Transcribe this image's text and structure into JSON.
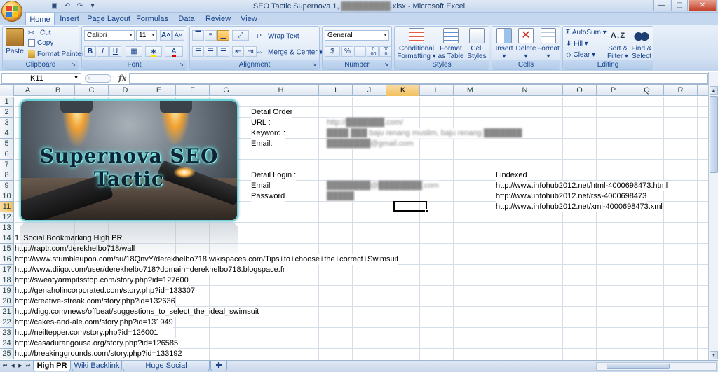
{
  "window": {
    "title": "SEO Tactic Supernova 1,",
    "title_suffix": ".xlsx - Microsoft Excel",
    "title_blurred": "█████████",
    "controls": {
      "minimize": "—",
      "maximize": "▢",
      "close": "✕"
    }
  },
  "quick_access": [
    "save-icon",
    "undo-icon",
    "redo-icon",
    "customize-icon"
  ],
  "tabs": [
    "Home",
    "Insert",
    "Page Layout",
    "Formulas",
    "Data",
    "Review",
    "View"
  ],
  "active_tab": "Home",
  "ribbon": {
    "clipboard": {
      "label": "Clipboard",
      "paste": "Paste",
      "cut": "Cut",
      "copy": "Copy",
      "format_painter": "Format Painter"
    },
    "font": {
      "label": "Font",
      "name": "Calibri",
      "size": "11",
      "bold": "B",
      "italic": "I",
      "underline": "U",
      "grow": "A",
      "shrink": "A"
    },
    "alignment": {
      "label": "Alignment",
      "wrap_text": "Wrap Text",
      "merge_center": "Merge & Center"
    },
    "number": {
      "label": "Number",
      "format": "General",
      "currency": "$",
      "percent": "%",
      "comma": ",",
      "inc_decimal": ".0 .00",
      "dec_decimal": ".00 .0"
    },
    "styles": {
      "label": "Styles",
      "conditional_1": "Conditional",
      "conditional_2": "Formatting",
      "format_table_1": "Format",
      "format_table_2": "as Table",
      "cell_styles_1": "Cell",
      "cell_styles_2": "Styles"
    },
    "cells": {
      "label": "Cells",
      "insert": "Insert",
      "delete": "Delete",
      "format": "Format"
    },
    "editing": {
      "label": "Editing",
      "autosum": "AutoSum",
      "fill": "Fill",
      "clear": "Clear",
      "sort_1": "Sort &",
      "sort_2": "Filter",
      "find_1": "Find &",
      "find_2": "Select"
    }
  },
  "formula_bar": {
    "name_box": "K11",
    "fx": "fx",
    "value": ""
  },
  "columns": [
    "A",
    "B",
    "C",
    "D",
    "E",
    "F",
    "G",
    "H",
    "I",
    "J",
    "K",
    "L",
    "M",
    "N",
    "O",
    "P",
    "Q",
    "R"
  ],
  "selected_column": "K",
  "rows": [
    "1",
    "2",
    "3",
    "4",
    "5",
    "6",
    "7",
    "8",
    "9",
    "10",
    "11",
    "12",
    "13",
    "14",
    "15",
    "16",
    "17",
    "18",
    "19",
    "20",
    "21",
    "22",
    "23",
    "24",
    "25"
  ],
  "selected_row": "11",
  "banner": {
    "title": "Supernova SEO Tactic"
  },
  "details": {
    "detail_order": "Detail Order",
    "url_label": "URL :",
    "url_value": "http://███████.com/",
    "keyword_label": "Keyword :",
    "keyword_value": "████ ███ baju renang muslim, baju renang ███████",
    "email_label": "Email:",
    "email_value": "████████@gmail.com",
    "detail_login": "Detail Login :",
    "login_email_label": "Email",
    "login_email_value": "████████@████████.com",
    "password_label": "Password",
    "password_value": "█████"
  },
  "lindexed": {
    "label": "Lindexed",
    "links": [
      "http://www.infohub2012.net/html-4000698473.html",
      "http://www.infohub2012.net/rss-4000698473",
      "http://www.infohub2012.net/xml-4000698473.xml"
    ]
  },
  "bookmarks": {
    "heading": "1. Social Bookmarking High PR",
    "links": [
      "http://raptr.com/derekhelbo718/wall",
      "http://www.stumbleupon.com/su/18QnvY/derekhelbo718.wikispaces.com/Tips+to+choose+the+correct+Swimsuit",
      "http://www.diigo.com/user/derekhelbo718?domain=derekhelbo718.blogspace.fr",
      "http://sweatyarmpitsstop.com/story.php?id=127600",
      "http://genaholincorporated.com/story.php?id=133307",
      "http://creative-streak.com/story.php?id=132636",
      "http://digg.com/news/offbeat/suggestions_to_select_the_ideal_swimsuit",
      "http://cakes-and-ale.com/story.php?id=131949",
      "http://neiltepper.com/story.php?id=126001",
      "http://casadurangousa.org/story.php?id=126585",
      "http://breakinggrounds.com/story.php?id=133192"
    ]
  },
  "sheet_tabs": [
    "High PR",
    "Wiki Backlink",
    "Huge Social Bookmarking"
  ],
  "active_sheet": "High PR"
}
